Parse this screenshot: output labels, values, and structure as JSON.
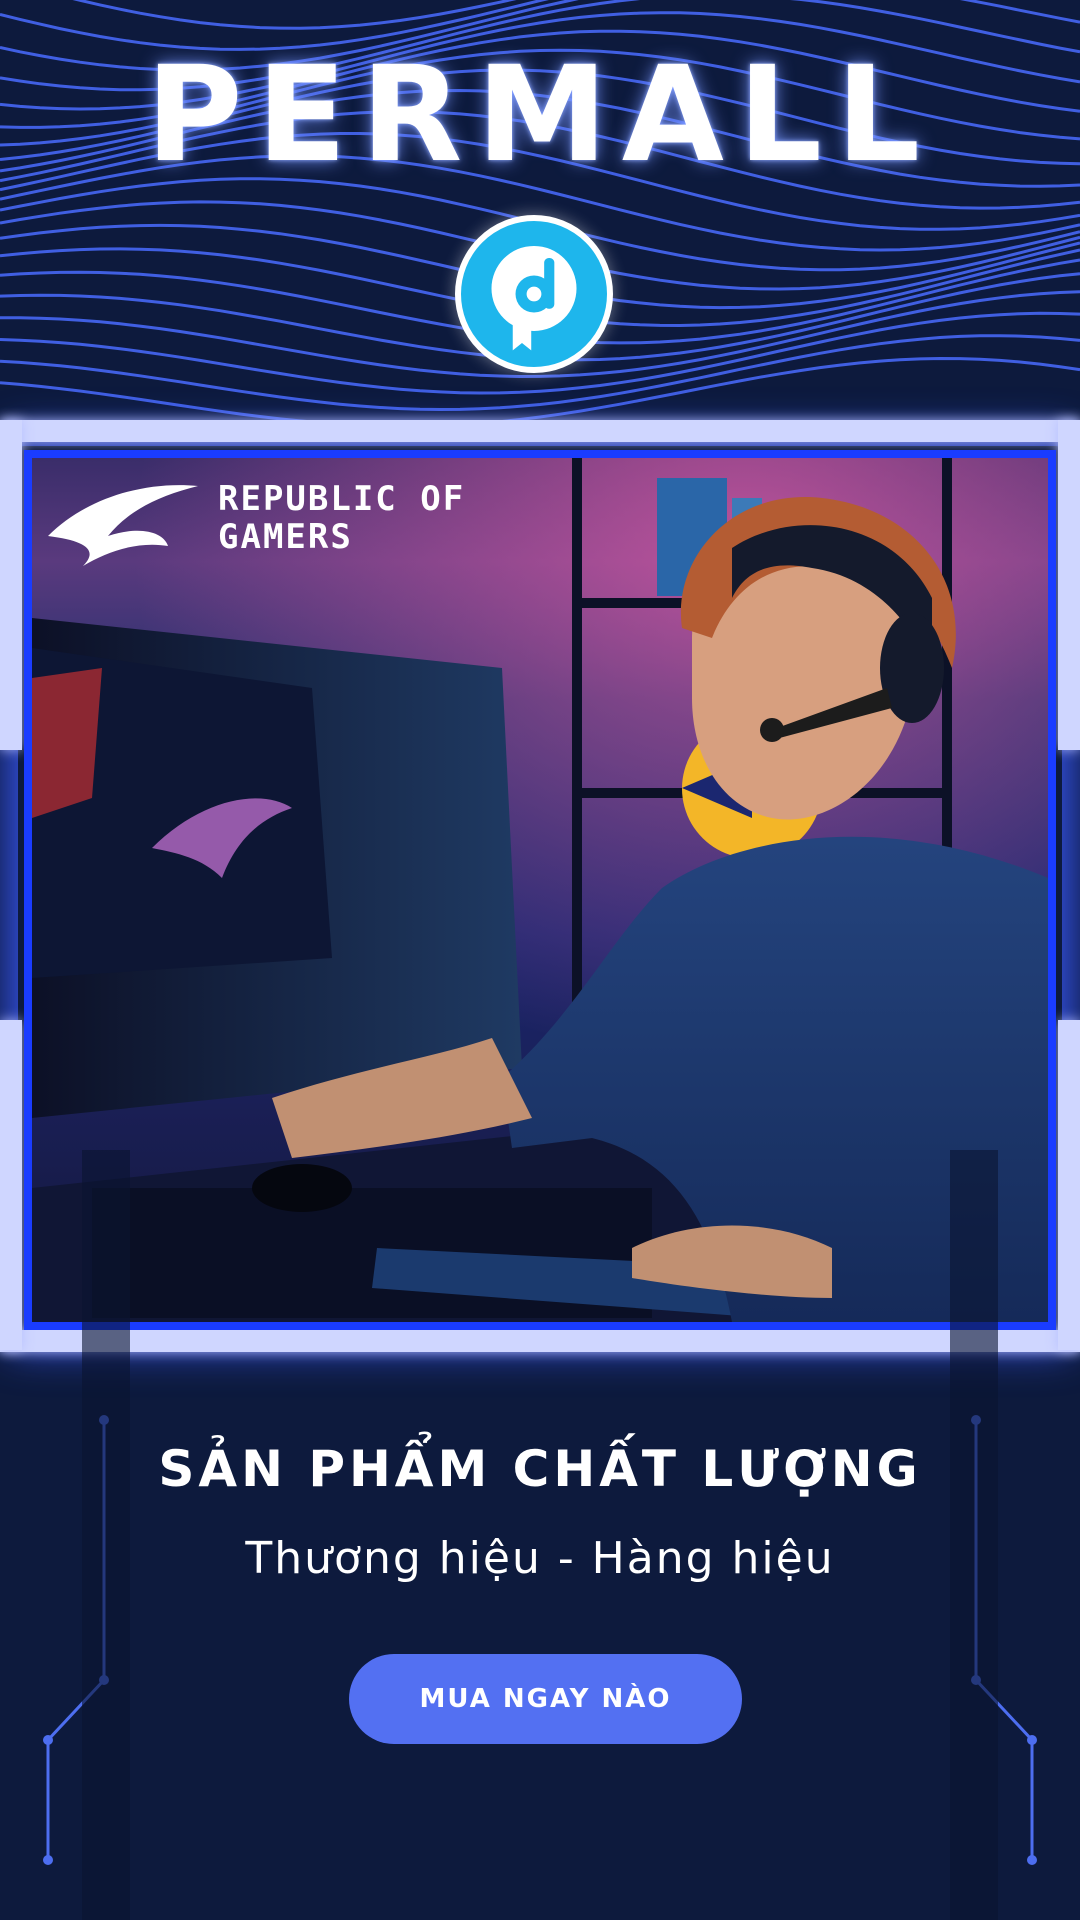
{
  "brand": {
    "name": "PERMALL",
    "badge_icon": "permall-badge-icon"
  },
  "banner": {
    "logo_text_line1": "REPUBLIC OF",
    "logo_text_line2": "GAMERS",
    "image": "gamer-at-desk-photo"
  },
  "promo": {
    "headline": "SẢN PHẨM CHẤT LƯỢNG",
    "subheadline": "Thương hiệu - Hàng hiệu",
    "cta_label": "MUA NGAY NÀO"
  },
  "colors": {
    "background": "#0d1a3d",
    "wave_lines": "#4a6cff",
    "frame_glow": "#1a3cff",
    "badge": "#1eb6ec",
    "button": "#5370f2"
  }
}
